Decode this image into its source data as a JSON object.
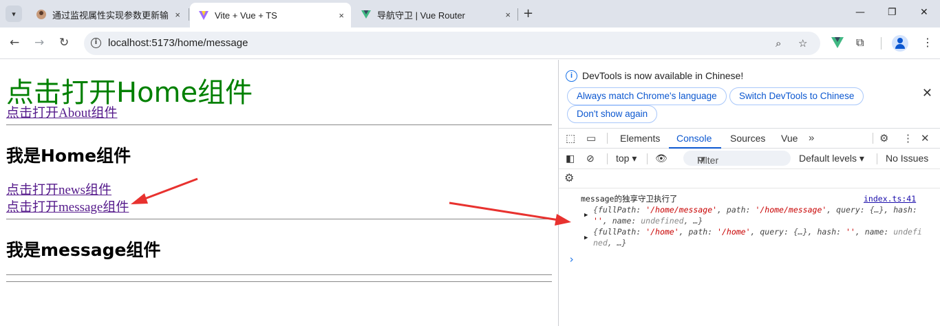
{
  "browser": {
    "tabs": [
      {
        "title": "通过监视属性实现参数更新输出",
        "close": "×"
      },
      {
        "title": "Vite + Vue + TS",
        "close": "×"
      },
      {
        "title": "导航守卫 | Vue Router",
        "close": "×"
      }
    ],
    "new_tab": "+",
    "url": "localhost:5173/home/message"
  },
  "page": {
    "home_link": "点击打开Home组件",
    "about_link": "点击打开About组件",
    "home_heading": "我是Home组件",
    "news_link": "点击打开news组件",
    "message_link": "点击打开message组件",
    "message_heading": "我是message组件"
  },
  "devtools": {
    "infobar": {
      "message": "DevTools is now available in Chinese!",
      "btn_match": "Always match Chrome's language",
      "btn_switch": "Switch DevTools to Chinese",
      "btn_dont_show": "Don't show again"
    },
    "tabs": [
      "Elements",
      "Console",
      "Sources",
      "Vue"
    ],
    "active_tab": "Console",
    "console_bar": {
      "context": "top",
      "filter_placeholder": "Filter",
      "levels": "Default levels",
      "issues": "No Issues"
    },
    "log": {
      "message": "message的独享守卫执行了",
      "source": "index.ts:41",
      "to": {
        "fullPath": "'/home/message'",
        "path": "'/home/message'",
        "query": "{…}",
        "hash": "''",
        "name": "undefined"
      },
      "from": {
        "fullPath": "'/home'",
        "path": "'/home'",
        "query": "{…}",
        "hash": "''",
        "name": "undefined"
      }
    }
  },
  "colors": {
    "accent": "#0b57d0",
    "link_visited": "#551a8b",
    "heading_green": "#008000",
    "annotation_arrow": "#e8322f"
  }
}
